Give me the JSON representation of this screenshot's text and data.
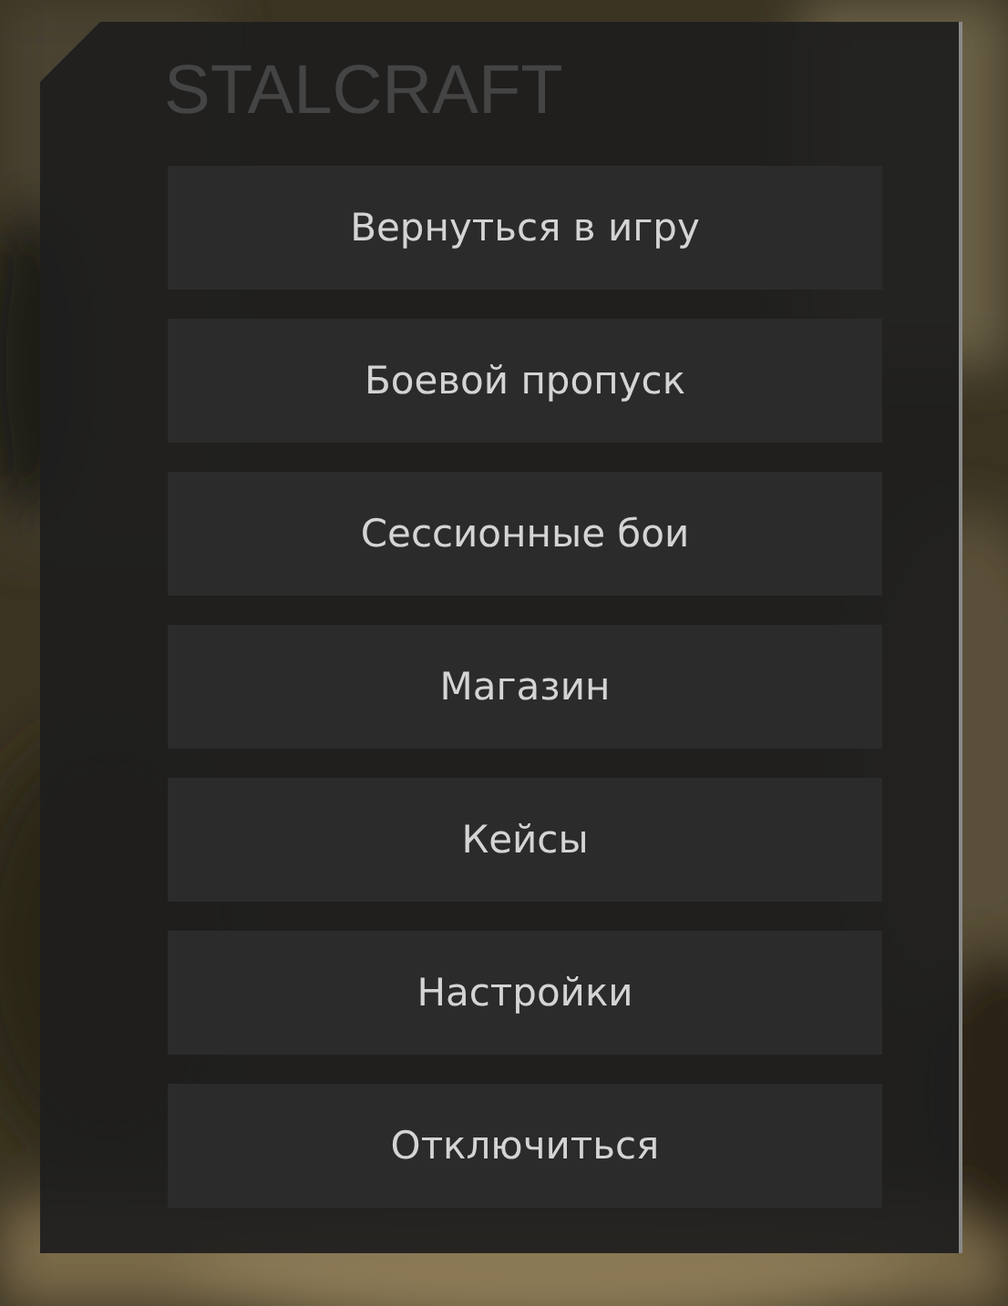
{
  "title": "STALCRAFT",
  "buttons": [
    {
      "label": "Вернуться в игру"
    },
    {
      "label": "Боевой пропуск"
    },
    {
      "label": "Сессионные бои"
    },
    {
      "label": "Магазин"
    },
    {
      "label": "Кейсы"
    },
    {
      "label": "Настройки"
    },
    {
      "label": "Отключиться"
    }
  ]
}
